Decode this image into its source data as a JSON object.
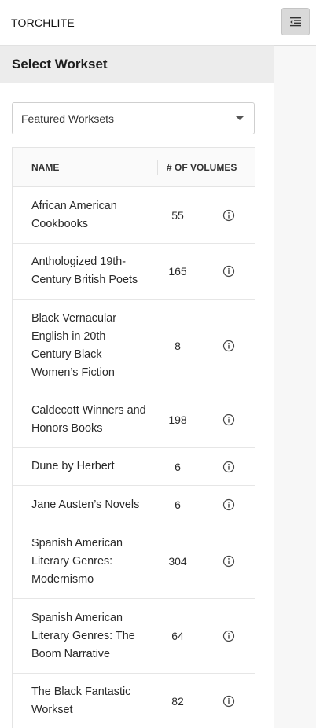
{
  "app": {
    "title": "TORCHLITE"
  },
  "sidebar": {
    "section_title": "Select Workset"
  },
  "workset_select": {
    "selected": "Featured Worksets"
  },
  "table": {
    "headers": {
      "name": "NAME",
      "volumes": "# OF VOLUMES"
    },
    "rows": [
      {
        "name": "African American Cookbooks",
        "volumes": "55"
      },
      {
        "name": "Anthologized 19th-Century British Poets",
        "volumes": "165"
      },
      {
        "name": "Black Vernacular English in 20th Century Black Women’s Fiction",
        "volumes": "8"
      },
      {
        "name": "Caldecott Winners and Honors Books",
        "volumes": "198"
      },
      {
        "name": "Dune by Herbert",
        "volumes": "6"
      },
      {
        "name": "Jane Austen’s Novels",
        "volumes": "6"
      },
      {
        "name": "Spanish American Literary Genres: Modernismo",
        "volumes": "304"
      },
      {
        "name": "Spanish American Literary Genres: The Boom Narrative",
        "volumes": "64"
      },
      {
        "name": "The Black Fantastic Workset",
        "volumes": "82"
      }
    ]
  },
  "icons": {
    "toggle": "indent-menu-icon",
    "row_info": "info-icon",
    "select_caret": "caret-down-icon"
  },
  "colors": {
    "section_bg": "#ececec",
    "rail_bg": "#f7f7f7",
    "toggle_bg": "#d9d9d9"
  }
}
